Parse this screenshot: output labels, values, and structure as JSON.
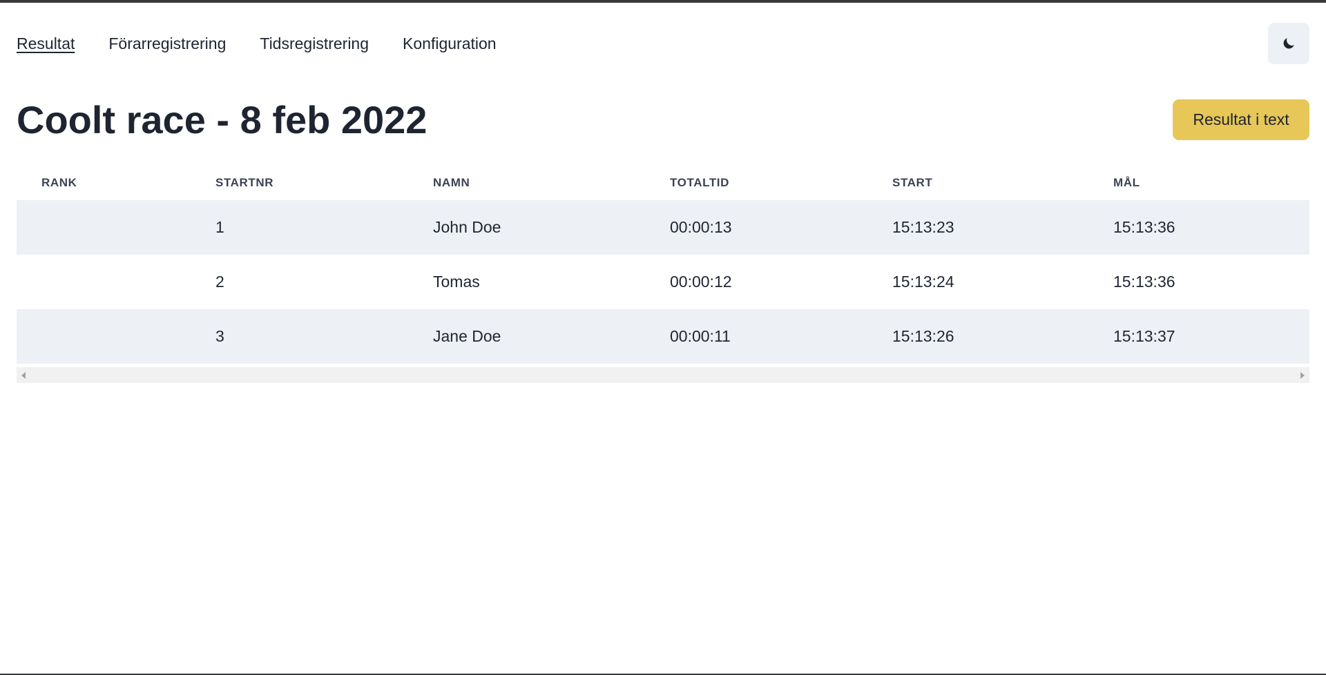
{
  "nav": {
    "items": [
      {
        "label": "Resultat",
        "active": true
      },
      {
        "label": "Förarregistrering",
        "active": false
      },
      {
        "label": "Tidsregistrering",
        "active": false
      },
      {
        "label": "Konfiguration",
        "active": false
      }
    ],
    "theme_toggle_icon": "moon-icon"
  },
  "header": {
    "title": "Coolt race - 8 feb 2022",
    "text_results_button": "Resultat i text"
  },
  "table": {
    "columns": [
      "RANK",
      "STARTNR",
      "NAMN",
      "TOTALTID",
      "START",
      "MÅL"
    ],
    "rows": [
      {
        "rank": "",
        "startnr": "1",
        "namn": "John Doe",
        "totaltid": "00:00:13",
        "start": "15:13:23",
        "mal": "15:13:36"
      },
      {
        "rank": "",
        "startnr": "2",
        "namn": "Tomas",
        "totaltid": "00:00:12",
        "start": "15:13:24",
        "mal": "15:13:36"
      },
      {
        "rank": "",
        "startnr": "3",
        "namn": "Jane Doe",
        "totaltid": "00:00:11",
        "start": "15:13:26",
        "mal": "15:13:37"
      }
    ]
  },
  "colors": {
    "accent_button": "#e6c758",
    "row_stripe": "#edf0f4",
    "text": "#1f2431"
  }
}
